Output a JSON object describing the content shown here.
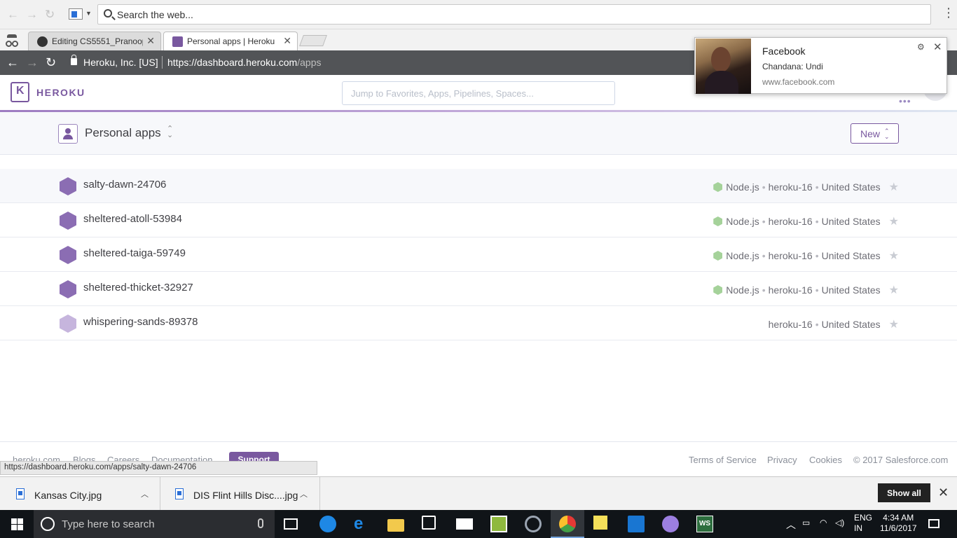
{
  "outer": {
    "search_text": "Search the web..."
  },
  "tabs": [
    {
      "label": "Editing CS5551_Pranoop",
      "favicon_color": "#333333"
    },
    {
      "label": "Personal apps | Heroku",
      "favicon_color": "#79589f"
    }
  ],
  "address": {
    "org": "Heroku, Inc. [US]",
    "url_base": "https://dashboard.heroku.com",
    "url_path": "/apps"
  },
  "heroku": {
    "wordmark": "HEROKU",
    "search_placeholder": "Jump to Favorites, Apps, Pipelines, Spaces...",
    "context_label": "Personal apps",
    "new_button": "New",
    "brand_color": "#79589f"
  },
  "apps": [
    {
      "name": "salty-dawn-24706",
      "buildpack": "Node.js",
      "stack": "heroku-16",
      "region": "United States"
    },
    {
      "name": "sheltered-atoll-53984",
      "buildpack": "Node.js",
      "stack": "heroku-16",
      "region": "United States"
    },
    {
      "name": "sheltered-taiga-59749",
      "buildpack": "Node.js",
      "stack": "heroku-16",
      "region": "United States"
    },
    {
      "name": "sheltered-thicket-32927",
      "buildpack": "Node.js",
      "stack": "heroku-16",
      "region": "United States"
    },
    {
      "name": "whispering-sands-89378",
      "buildpack": "",
      "stack": "heroku-16",
      "region": "United States"
    }
  ],
  "footer": {
    "links_left": [
      "heroku.com",
      "Blogs",
      "Careers",
      "Documentation"
    ],
    "support": "Support",
    "links_right": [
      "Terms of Service",
      "Privacy",
      "Cookies"
    ],
    "copyright": "© 2017 Salesforce.com"
  },
  "status_url": "https://dashboard.heroku.com/apps/salty-dawn-24706",
  "downloads": {
    "items": [
      "Kansas City.jpg",
      "DIS Flint Hills Disc....jpg"
    ],
    "show_all": "Show all"
  },
  "taskbar": {
    "search_placeholder": "Type here to search",
    "lang_line1": "ENG",
    "lang_line2": "IN",
    "time": "4:34 AM",
    "date": "11/6/2017"
  },
  "notification": {
    "title": "Facebook",
    "message": "Chandana: Undi",
    "source": "www.facebook.com"
  }
}
